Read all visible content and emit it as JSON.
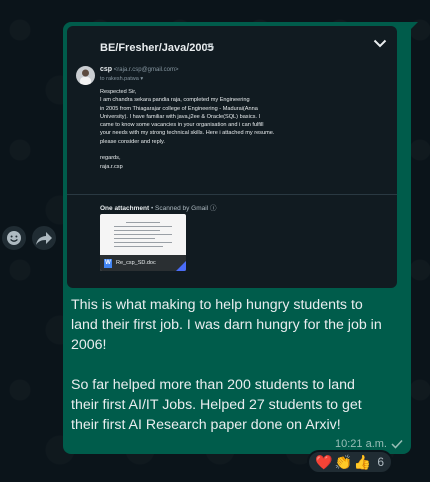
{
  "email": {
    "subject": "BE/Fresher/Java/2005",
    "sender_name": "csp",
    "sender_email": "<raja.r.csp@gmail.com>",
    "to_line": "to rakesh.patwa",
    "body": "Respected Sir,\n              I am chandra sekara pandia raja, completed my Engineering\nin 2005 from Thiagarajar college of Engineering - Madurai(Anna\nUniversity). I have familiar with java,j2ee & Oracle(SQL) basics. I\ncame to know some vacancies in your organisation and i can fulfill\nyour needs with my strong technical skills. Here i attached my resume.\nplease consider and reply.\n\nregards,\nraja.r.csp",
    "attachment_header": "One attachment",
    "scan_note": "• Scanned by Gmail",
    "attachment_name": "Re_csp_SD.doc"
  },
  "message": {
    "paragraph1": "This is what making to help hungry students to land their first job. I was darn hungry for the job in 2006!",
    "paragraph2": "So far helped more than 200 students to land their first AI/IT Jobs. Helped 27 students to get their first AI Research paper done on Arxiv!",
    "time": "10:21 a.m."
  },
  "reactions": {
    "emojis": [
      "❤️",
      "👏",
      "👍"
    ],
    "count": "6"
  },
  "icons": {
    "emoji_button": "smiley-icon",
    "forward_button": "forward-icon",
    "expand": "chevron-down-icon",
    "status": "check-icon"
  },
  "colors": {
    "bubble": "#005c4b",
    "background": "#0b141a"
  }
}
